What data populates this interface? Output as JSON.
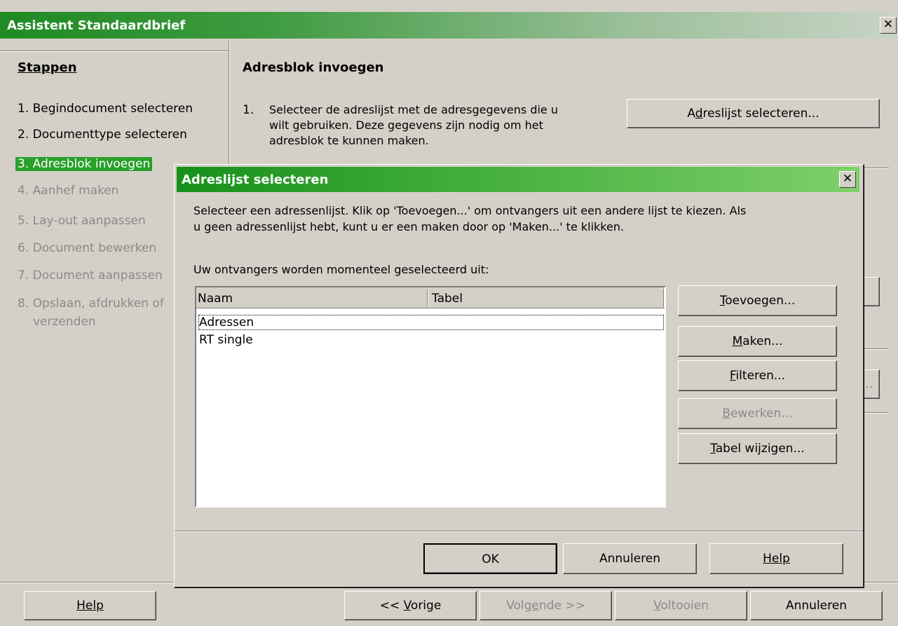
{
  "window": {
    "title": "Assistent Standaardbrief",
    "close": "✕"
  },
  "sidebar": {
    "heading": "Stappen",
    "steps": [
      "1. Begindocument selecteren",
      "2. Documenttype selecteren",
      "3. Adresblok invoegen",
      "4. Aanhef maken",
      "5. Lay-out aanpassen",
      "6. Document bewerken",
      "7. Document aanpassen",
      "8. Opslaan, afdrukken of",
      "verzenden"
    ]
  },
  "main": {
    "heading": "Adresblok invoegen",
    "step1_number": "1.",
    "step1_line1": "Selecteer de adreslijst met de adresgegevens die u",
    "step1_line2": "wilt gebruiken. Deze gegevens zijn nodig om het",
    "step1_line3": "adresblok te kunnen maken.",
    "select_list_btn": {
      "pre": "A",
      "u": "d",
      "post": "reslijst selecteren..."
    },
    "obscured_btn_tail": "..."
  },
  "footer": {
    "help": "Help",
    "prev": {
      "pre": "<< ",
      "u": "V",
      "post": "orige"
    },
    "next": {
      "pre": "Volg",
      "u": "e",
      "post": "nde >>"
    },
    "finish": {
      "pre": "",
      "u": "V",
      "post": "oltooien"
    },
    "cancel": "Annuleren"
  },
  "dialog": {
    "title": "Adreslijst selecteren",
    "close": "✕",
    "desc_line1": "Selecteer een adressenlijst. Klik op 'Toevoegen...' om ontvangers uit een andere lijst te kiezen. Als",
    "desc_line2": "u geen adressenlijst hebt, kunt u er een maken door op 'Maken...' te klikken.",
    "current_label": "Uw ontvangers worden momenteel geselecteerd uit:",
    "columns": [
      "Naam",
      "Tabel"
    ],
    "rows": [
      {
        "naam": "Adressen",
        "tabel": ""
      },
      {
        "naam": "RT single",
        "tabel": ""
      }
    ],
    "buttons": {
      "add": {
        "pre": "",
        "u": "T",
        "post": "oevoegen..."
      },
      "create": {
        "pre": "",
        "u": "M",
        "post": "aken..."
      },
      "filter": {
        "pre": "",
        "u": "F",
        "post": "ilteren..."
      },
      "edit": {
        "pre": "",
        "u": "B",
        "post": "ewerken..."
      },
      "change_table": {
        "pre": "",
        "u": "T",
        "post": "abel wijzigen..."
      },
      "ok": "OK",
      "cancel": "Annuleren",
      "help": "Help"
    }
  }
}
